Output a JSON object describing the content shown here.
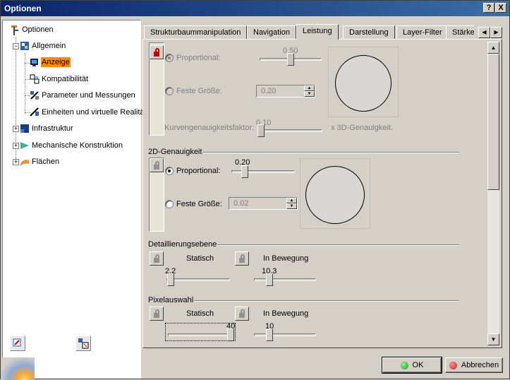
{
  "window": {
    "title": "Optionen",
    "help_label": "?",
    "close_label": "X"
  },
  "tree": {
    "root": "Optionen",
    "items": [
      {
        "label": "Allgemein"
      },
      {
        "label": "Anzeige",
        "selected": true
      },
      {
        "label": "Kompatibilität"
      },
      {
        "label": "Parameter und Messungen"
      },
      {
        "label": "Einheiten und virtuelle Realitä"
      },
      {
        "label": "Infrastruktur"
      },
      {
        "label": "Mechanische Konstruktion"
      },
      {
        "label": "Flächen"
      }
    ]
  },
  "tabs": [
    {
      "label": "Strukturbaummanipulation"
    },
    {
      "label": "Navigation"
    },
    {
      "label": "Leistung",
      "active": true
    },
    {
      "label": "Darstellung"
    },
    {
      "label": "Layer-Filter"
    },
    {
      "label": "Stärke"
    }
  ],
  "tab_scroll": {
    "left": "◀",
    "right": "▶"
  },
  "section_3d": {
    "proportional_label": "Proportional:",
    "proportional_value": "0.50",
    "fixed_label": "Feste Größe:",
    "fixed_value": "0.20",
    "curve_label": "Kurvengenauigkeitsfaktor:",
    "curve_value": "0.10",
    "curve_suffix": "x 3D-Genauigkeit."
  },
  "section_2d": {
    "title": "2D-Genauigkeit",
    "proportional_label": "Proportional:",
    "proportional_value": "0.20",
    "fixed_label": "Feste Größe:",
    "fixed_value": "0.02"
  },
  "detail": {
    "title": "Detaillierungsebene",
    "static_label": "Statisch",
    "static_value": "2.2",
    "moving_label": "In Bewegung",
    "moving_value": "10.3"
  },
  "pixel": {
    "title": "Pixelauswahl",
    "static_label": "Statisch",
    "static_value": "40",
    "moving_label": "In Bewegung",
    "moving_value": "10"
  },
  "buttons": {
    "ok": "OK",
    "cancel": "Abbrechen"
  },
  "colors": {
    "title_start": "#0a246a",
    "title_end": "#3a6ea5",
    "selection": "#ff8c00",
    "ok_dot": "#1fa01f",
    "cancel_dot": "#d01818"
  }
}
